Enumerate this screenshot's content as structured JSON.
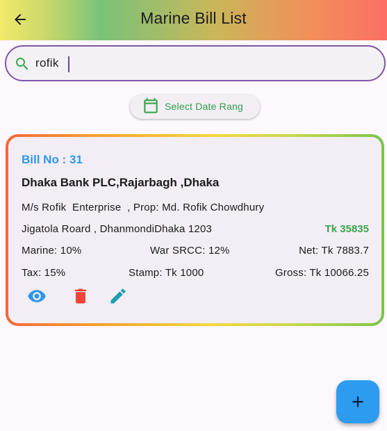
{
  "appbar": {
    "title": "Marine Bill List"
  },
  "search": {
    "value": "rofik"
  },
  "date_filter": {
    "label": "Select Date Rang"
  },
  "bill": {
    "bill_no": "Bill No : 31",
    "bank": "Dhaka Bank PLC,Rajarbagh ,Dhaka",
    "owner": "M/s Rofik  Enterprise  , Prop: Md. Rofik Chowdhury",
    "address": "Jigatola Roard , DhanmondiDhaka 1203",
    "amount": "Tk 35835",
    "marine": "Marine: 10%",
    "war_srcc": "War SRCC: 12%",
    "net": "Net: Tk 7883.7",
    "tax": "Tax: 15%",
    "stamp": "Stamp: Tk 1000",
    "gross": "Gross: Tk 10066.25"
  },
  "colors": {
    "accent_blue": "#2e97e8",
    "green": "#3aa64a",
    "delete_red": "#f0443b",
    "edit_teal": "#1a9fb0",
    "fab_blue": "#2d9bf0"
  },
  "icons": [
    "arrow-back-icon",
    "search-icon",
    "calendar-icon",
    "eye-icon",
    "trash-icon",
    "pencil-icon",
    "plus-icon"
  ]
}
